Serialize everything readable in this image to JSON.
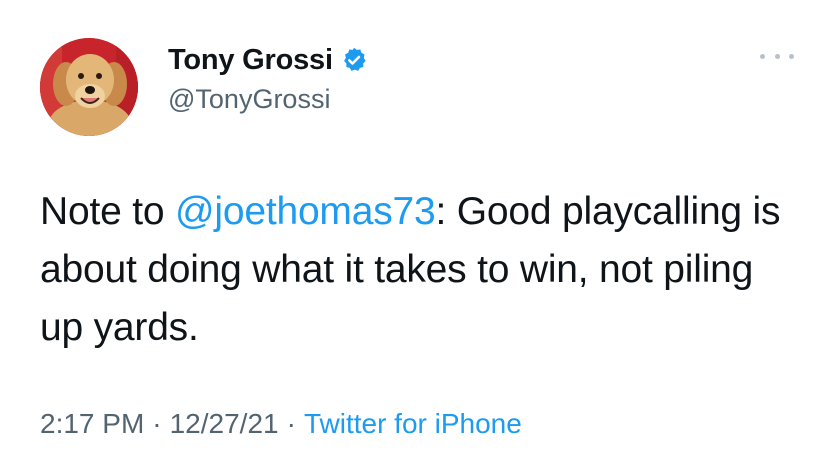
{
  "author": {
    "display_name": "Tony Grossi",
    "handle": "@TonyGrossi",
    "verified": true
  },
  "more_icon": "more-horizontal-icon",
  "tweet": {
    "text_before": "Note to ",
    "mention": "@joethomas73",
    "text_after": ": Good playcalling is about doing what it takes to win, not piling up yards."
  },
  "meta": {
    "time": "2:17 PM",
    "separator": "·",
    "date": "12/27/21",
    "source": "Twitter for iPhone"
  },
  "colors": {
    "accent": "#1d9bf0",
    "text": "#0f1419",
    "secondary": "#536471"
  }
}
